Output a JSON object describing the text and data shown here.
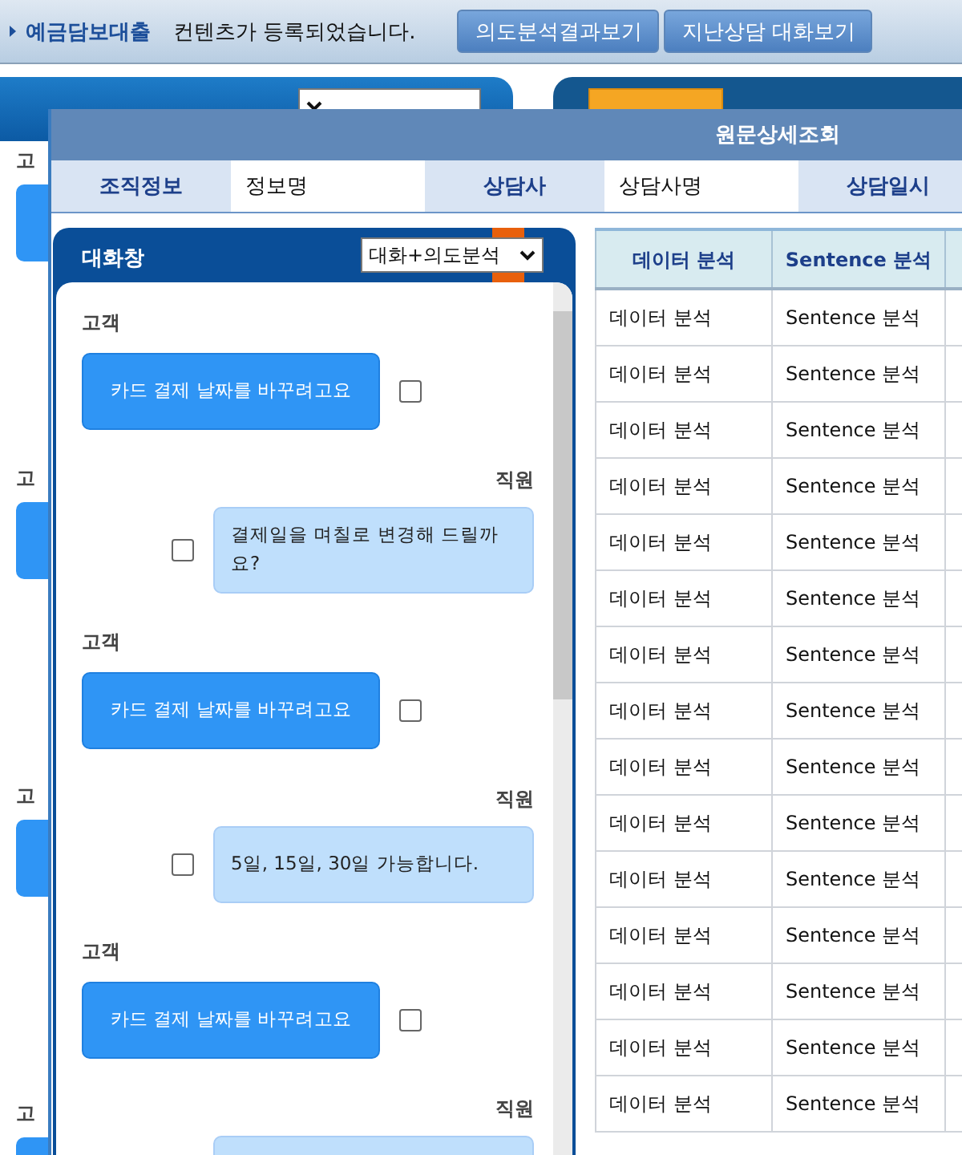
{
  "top_bar": {
    "breadcrumb": "예금담보대출",
    "message": "컨텐츠가 등록되었습니다.",
    "buttons": [
      "의도분석결과보기",
      "지난상담 대화보기"
    ]
  },
  "background_panel": {
    "labels": [
      "고",
      "고",
      "고",
      "고"
    ]
  },
  "modal": {
    "title": "원문상세조회",
    "info_row": [
      {
        "kind": "label",
        "text": "조직정보"
      },
      {
        "kind": "value",
        "text": "정보명"
      },
      {
        "kind": "label",
        "text": "상담사"
      },
      {
        "kind": "value",
        "text": "상담사명"
      },
      {
        "kind": "label",
        "text": "상담일시"
      }
    ],
    "chat": {
      "title": "대화창",
      "select_value": "대화+의도분석",
      "messages": [
        {
          "kind": "customer",
          "speaker": "고객",
          "text": "카드 결제 날짜를 바꾸려고요",
          "checked": false
        },
        {
          "kind": "staff",
          "speaker": "직원",
          "text": "결제일을 며칠로 변경해 드릴까요?",
          "checked": false
        },
        {
          "kind": "customer",
          "speaker": "고객",
          "text": "카드 결제 날짜를 바꾸려고요",
          "checked": false
        },
        {
          "kind": "staff",
          "speaker": "직원",
          "text": "5일, 15일, 30일 가능합니다.",
          "checked": false
        },
        {
          "kind": "customer",
          "speaker": "고객",
          "text": "카드 결제 날짜를 바꾸려고요",
          "checked": false
        },
        {
          "kind": "staff",
          "speaker": "직원"
        }
      ]
    },
    "table": {
      "columns": [
        "데이터 분석",
        "Sentence 분석"
      ],
      "rows": [
        [
          "데이터 분석",
          "Sentence 분석"
        ],
        [
          "데이터 분석",
          "Sentence 분석"
        ],
        [
          "데이터 분석",
          "Sentence 분석"
        ],
        [
          "데이터 분석",
          "Sentence 분석"
        ],
        [
          "데이터 분석",
          "Sentence 분석"
        ],
        [
          "데이터 분석",
          "Sentence 분석"
        ],
        [
          "데이터 분석",
          "Sentence 분석"
        ],
        [
          "데이터 분석",
          "Sentence 분석"
        ],
        [
          "데이터 분석",
          "Sentence 분석"
        ],
        [
          "데이터 분석",
          "Sentence 분석"
        ],
        [
          "데이터 분석",
          "Sentence 분석"
        ],
        [
          "데이터 분석",
          "Sentence 분석"
        ],
        [
          "데이터 분석",
          "Sentence 분석"
        ],
        [
          "데이터 분석",
          "Sentence 분석"
        ],
        [
          "데이터 분석",
          "Sentence 분석"
        ]
      ]
    }
  }
}
